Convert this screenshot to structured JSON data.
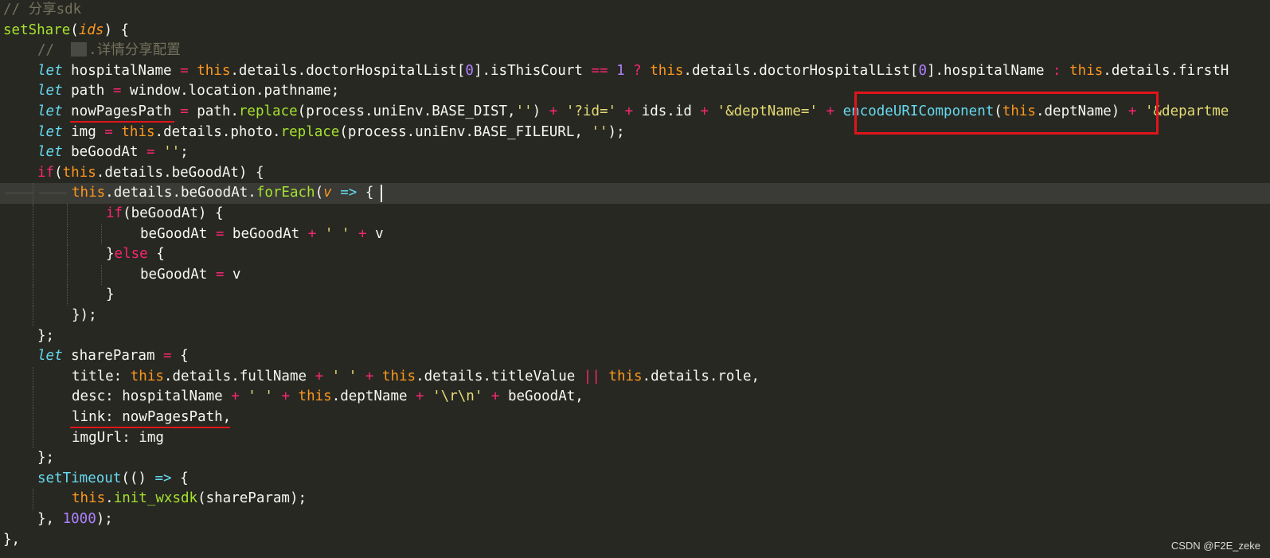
{
  "editor": {
    "lines": [
      {
        "indent": 0,
        "tokens": [
          [
            "cm",
            "// 分享sdk"
          ]
        ]
      },
      {
        "indent": 0,
        "tokens": [
          [
            "fn",
            "setShare"
          ],
          [
            "tx",
            "("
          ],
          [
            "param",
            "ids"
          ],
          [
            "tx",
            ") {"
          ]
        ]
      },
      {
        "indent": 1,
        "tokens": [
          [
            "cm",
            "//  "
          ],
          [
            "img",
            ""
          ],
          [
            "cm",
            ".详情分享配置"
          ]
        ]
      },
      {
        "indent": 1,
        "tokens": [
          [
            "kw",
            "let"
          ],
          [
            "tx",
            " hospitalName "
          ],
          [
            "op",
            "="
          ],
          [
            "tx",
            " "
          ],
          [
            "this",
            "this"
          ],
          [
            "tx",
            ".details.doctorHospitalList["
          ],
          [
            "num",
            "0"
          ],
          [
            "tx",
            "].isThisCourt "
          ],
          [
            "op",
            "=="
          ],
          [
            "tx",
            " "
          ],
          [
            "num",
            "1"
          ],
          [
            "tx",
            " "
          ],
          [
            "op",
            "?"
          ],
          [
            "tx",
            " "
          ],
          [
            "this",
            "this"
          ],
          [
            "tx",
            ".details.doctorHospitalList["
          ],
          [
            "num",
            "0"
          ],
          [
            "tx",
            "].hospitalName "
          ],
          [
            "op",
            ":"
          ],
          [
            "tx",
            " "
          ],
          [
            "this",
            "this"
          ],
          [
            "tx",
            ".details.firstH"
          ]
        ]
      },
      {
        "indent": 1,
        "tokens": [
          [
            "kw",
            "let"
          ],
          [
            "tx",
            " path "
          ],
          [
            "op",
            "="
          ],
          [
            "tx",
            " window.location.pathname;"
          ]
        ]
      },
      {
        "indent": 1,
        "tokens": [
          [
            "kw",
            "let"
          ],
          [
            "tx",
            " nowPagesPath "
          ],
          [
            "op",
            "="
          ],
          [
            "tx",
            " path."
          ],
          [
            "fn",
            "replace"
          ],
          [
            "tx",
            "(process.uniEnv.BASE_DIST,"
          ],
          [
            "str",
            "''"
          ],
          [
            "tx",
            ") "
          ],
          [
            "op",
            "+"
          ],
          [
            "tx",
            " "
          ],
          [
            "str",
            "'?id='"
          ],
          [
            "tx",
            " "
          ],
          [
            "op",
            "+"
          ],
          [
            "tx",
            " ids.id "
          ],
          [
            "op",
            "+"
          ],
          [
            "tx",
            " "
          ],
          [
            "str",
            "'&deptName='"
          ],
          [
            "tx",
            " "
          ],
          [
            "op",
            "+"
          ],
          [
            "tx",
            " "
          ],
          [
            "call",
            "encodeURIComponent"
          ],
          [
            "tx",
            "("
          ],
          [
            "this",
            "this"
          ],
          [
            "tx",
            ".deptName) "
          ],
          [
            "op",
            "+"
          ],
          [
            "tx",
            " "
          ],
          [
            "str",
            "'&departme"
          ]
        ]
      },
      {
        "indent": 1,
        "tokens": [
          [
            "kw",
            "let"
          ],
          [
            "tx",
            " img "
          ],
          [
            "op",
            "="
          ],
          [
            "tx",
            " "
          ],
          [
            "this",
            "this"
          ],
          [
            "tx",
            ".details.photo."
          ],
          [
            "fn",
            "replace"
          ],
          [
            "tx",
            "(process.uniEnv.BASE_FILEURL, "
          ],
          [
            "str",
            "''"
          ],
          [
            "tx",
            ");"
          ]
        ]
      },
      {
        "indent": 1,
        "tokens": [
          [
            "kw",
            "let"
          ],
          [
            "tx",
            " beGoodAt "
          ],
          [
            "op",
            "="
          ],
          [
            "tx",
            " "
          ],
          [
            "str",
            "''"
          ],
          [
            "tx",
            ";"
          ]
        ]
      },
      {
        "indent": 1,
        "tokens": [
          [
            "op",
            "if"
          ],
          [
            "tx",
            "("
          ],
          [
            "this",
            "this"
          ],
          [
            "tx",
            ".details.beGoodAt) {"
          ]
        ]
      },
      {
        "indent": 2,
        "current": true,
        "tokens": [
          [
            "this",
            "this"
          ],
          [
            "tx",
            ".details.beGoodAt."
          ],
          [
            "fn",
            "forEach"
          ],
          [
            "tx",
            "("
          ],
          [
            "param",
            "v"
          ],
          [
            "tx",
            " "
          ],
          [
            "call",
            "=>"
          ],
          [
            "tx",
            " {"
          ]
        ]
      },
      {
        "indent": 3,
        "tokens": [
          [
            "op",
            "if"
          ],
          [
            "tx",
            "(beGoodAt) {"
          ]
        ]
      },
      {
        "indent": 4,
        "tokens": [
          [
            "tx",
            "beGoodAt "
          ],
          [
            "op",
            "="
          ],
          [
            "tx",
            " beGoodAt "
          ],
          [
            "op",
            "+"
          ],
          [
            "tx",
            " "
          ],
          [
            "str",
            "' '"
          ],
          [
            "tx",
            " "
          ],
          [
            "op",
            "+"
          ],
          [
            "tx",
            " v"
          ]
        ]
      },
      {
        "indent": 3,
        "tokens": [
          [
            "tx",
            "}"
          ],
          [
            "op",
            "else"
          ],
          [
            "tx",
            " {"
          ]
        ]
      },
      {
        "indent": 4,
        "tokens": [
          [
            "tx",
            "beGoodAt "
          ],
          [
            "op",
            "="
          ],
          [
            "tx",
            " v"
          ]
        ]
      },
      {
        "indent": 3,
        "tokens": [
          [
            "tx",
            "}"
          ]
        ]
      },
      {
        "indent": 2,
        "tokens": [
          [
            "tx",
            "});"
          ]
        ]
      },
      {
        "indent": 1,
        "tokens": [
          [
            "tx",
            "};"
          ]
        ]
      },
      {
        "indent": 1,
        "tokens": [
          [
            "kw",
            "let"
          ],
          [
            "tx",
            " shareParam "
          ],
          [
            "op",
            "="
          ],
          [
            "tx",
            " {"
          ]
        ]
      },
      {
        "indent": 2,
        "tokens": [
          [
            "tx",
            "title: "
          ],
          [
            "this",
            "this"
          ],
          [
            "tx",
            ".details.fullName "
          ],
          [
            "op",
            "+"
          ],
          [
            "tx",
            " "
          ],
          [
            "str",
            "' '"
          ],
          [
            "tx",
            " "
          ],
          [
            "op",
            "+"
          ],
          [
            "tx",
            " "
          ],
          [
            "this",
            "this"
          ],
          [
            "tx",
            ".details.titleValue "
          ],
          [
            "op",
            "||"
          ],
          [
            "tx",
            " "
          ],
          [
            "this",
            "this"
          ],
          [
            "tx",
            ".details.role,"
          ]
        ]
      },
      {
        "indent": 2,
        "tokens": [
          [
            "tx",
            "desc: hospitalName "
          ],
          [
            "op",
            "+"
          ],
          [
            "tx",
            " "
          ],
          [
            "str",
            "' '"
          ],
          [
            "tx",
            " "
          ],
          [
            "op",
            "+"
          ],
          [
            "tx",
            " "
          ],
          [
            "this",
            "this"
          ],
          [
            "tx",
            ".deptName "
          ],
          [
            "op",
            "+"
          ],
          [
            "tx",
            " "
          ],
          [
            "str",
            "'\\r\\n'"
          ],
          [
            "tx",
            " "
          ],
          [
            "op",
            "+"
          ],
          [
            "tx",
            " beGoodAt,"
          ]
        ]
      },
      {
        "indent": 2,
        "tokens": [
          [
            "tx",
            "link: nowPagesPath,"
          ]
        ]
      },
      {
        "indent": 2,
        "tokens": [
          [
            "tx",
            "imgUrl: img"
          ]
        ]
      },
      {
        "indent": 1,
        "tokens": [
          [
            "tx",
            "};"
          ]
        ]
      },
      {
        "indent": 1,
        "tokens": [
          [
            "call",
            "setTimeout"
          ],
          [
            "tx",
            "(() "
          ],
          [
            "call",
            "=>"
          ],
          [
            "tx",
            " {"
          ]
        ]
      },
      {
        "indent": 2,
        "tokens": [
          [
            "this",
            "this"
          ],
          [
            "tx",
            "."
          ],
          [
            "fn",
            "init_wxsdk"
          ],
          [
            "tx",
            "(shareParam);"
          ]
        ]
      },
      {
        "indent": 1,
        "tokens": [
          [
            "tx",
            "}, "
          ],
          [
            "num",
            "1000"
          ],
          [
            "tx",
            ");"
          ]
        ]
      },
      {
        "indent": 0,
        "tokens": [
          [
            "tx",
            "},"
          ]
        ]
      }
    ]
  },
  "annotations": {
    "box_target": "encodeURIComponent(this.deptName)",
    "underlined": [
      "nowPagesPath",
      "link: nowPagesPath,"
    ]
  },
  "watermark": "CSDN @F2E_zeke",
  "colors": {
    "background": "#272822",
    "current_line": "#3a3a36",
    "annotation_red": "#e0151b"
  }
}
